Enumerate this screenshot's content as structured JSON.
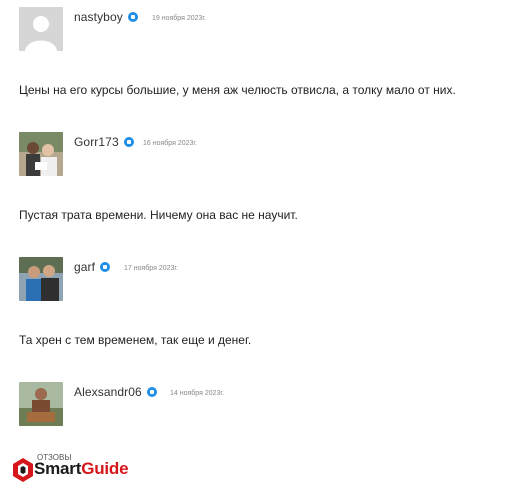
{
  "comments": [
    {
      "author": "nastyboy",
      "date": "19 ноября 2023г.",
      "text": "Цены на его курсы большие, у меня аж челюсть отвисла, а толку мало от них.",
      "avatar": "default-avatar-icon"
    },
    {
      "author": "Gorr173",
      "date": "16 ноября 2023г.",
      "text": "Пустая трата времени. Ничему она вас не научит.",
      "avatar": "photo"
    },
    {
      "author": "garf",
      "date": "17 ноября 2023г.",
      "text": "Та хрен с тем временем, так еще и денег.",
      "avatar": "photo"
    },
    {
      "author": "Alexsandr06",
      "date": "14 ноября 2023г.",
      "text": "",
      "avatar": "photo"
    }
  ],
  "logo": {
    "smart": "Smart",
    "guide": "Guide",
    "overlap_text": "ОТЗОВЫ"
  },
  "colors": {
    "verified": "#1e8ee6",
    "brand_red": "#d5161a"
  }
}
